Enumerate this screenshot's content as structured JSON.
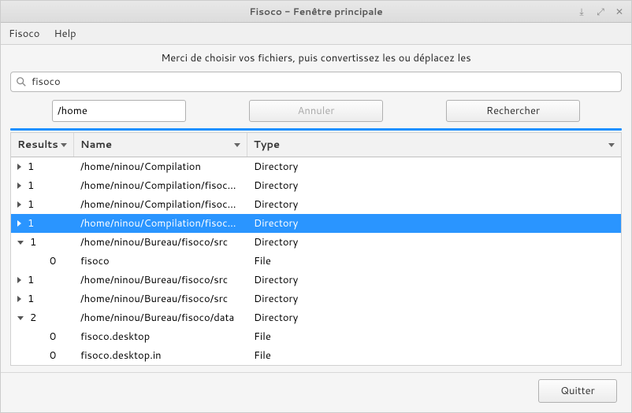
{
  "window": {
    "title": "Fisoco - Fenêtre principale"
  },
  "menu": {
    "fisoco": "Fisoco",
    "help": "Help"
  },
  "instruction": "Merci de choisir vos fichiers, puis convertissez les ou déplacez les",
  "search": {
    "value": "fisoco"
  },
  "toolbar": {
    "path": "/home",
    "cancel": "Annuler",
    "search": "Rechercher"
  },
  "columns": {
    "results": "Results",
    "name": "Name",
    "type": "Type"
  },
  "rows": [
    {
      "expander": "right",
      "indent": 0,
      "count": "1",
      "name": "/home/ninou/Compilation",
      "type": "Directory",
      "selected": false
    },
    {
      "expander": "right",
      "indent": 0,
      "count": "1",
      "name": "/home/ninou/Compilation/fisoco/src",
      "type": "Directory",
      "selected": false
    },
    {
      "expander": "right",
      "indent": 0,
      "count": "1",
      "name": "/home/ninou/Compilation/fisoco/src",
      "type": "Directory",
      "selected": false
    },
    {
      "expander": "right",
      "indent": 0,
      "count": "1",
      "name": "/home/ninou/Compilation/fisoco/src",
      "type": "Directory",
      "selected": true
    },
    {
      "expander": "down",
      "indent": 0,
      "count": "1",
      "name": "/home/ninou/Bureau/fisoco/src",
      "type": "Directory",
      "selected": false
    },
    {
      "expander": "none",
      "indent": 1,
      "count": "0",
      "name": "fisoco",
      "type": "File",
      "selected": false
    },
    {
      "expander": "right",
      "indent": 0,
      "count": "1",
      "name": "/home/ninou/Bureau/fisoco/src",
      "type": "Directory",
      "selected": false
    },
    {
      "expander": "right",
      "indent": 0,
      "count": "1",
      "name": "/home/ninou/Bureau/fisoco/src",
      "type": "Directory",
      "selected": false
    },
    {
      "expander": "down",
      "indent": 0,
      "count": "2",
      "name": "/home/ninou/Bureau/fisoco/data",
      "type": "Directory",
      "selected": false
    },
    {
      "expander": "none",
      "indent": 1,
      "count": "0",
      "name": "fisoco.desktop",
      "type": "File",
      "selected": false
    },
    {
      "expander": "none",
      "indent": 1,
      "count": "0",
      "name": "fisoco.desktop.in",
      "type": "File",
      "selected": false
    }
  ],
  "footer": {
    "quit": "Quitter"
  }
}
